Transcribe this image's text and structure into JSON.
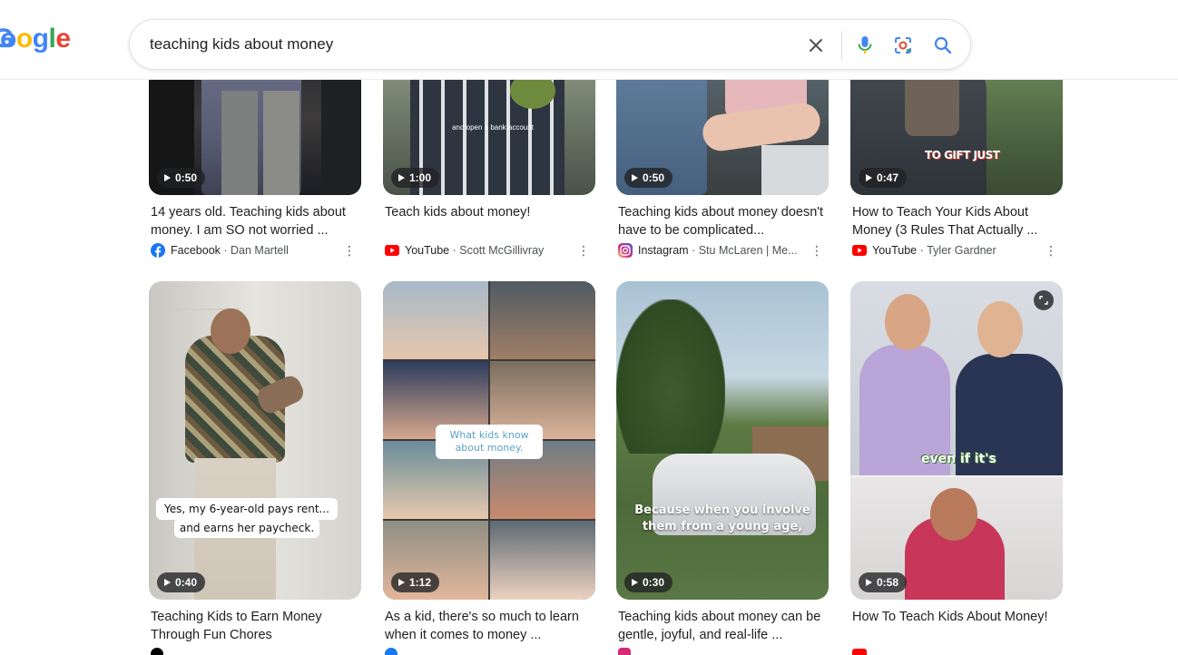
{
  "search": {
    "query": "teaching kids about money"
  },
  "logo": {
    "text_visible": "oogle"
  },
  "colors": {
    "facebook": "#1877f2",
    "youtube": "#ff0000",
    "instagram": "#e1306c",
    "tiktok": "#000000"
  },
  "row1": [
    {
      "duration": "0:50",
      "title": "14 years old. Teaching kids about money. I am SO not worried ...",
      "source_name": "Facebook",
      "source_author": "Dan Martell",
      "source_icon": "facebook-icon"
    },
    {
      "duration": "1:00",
      "title": "Teach kids about money!",
      "source_name": "YouTube",
      "source_author": "Scott McGillivray",
      "source_icon": "youtube-icon",
      "overlay_text": "and open a bank account"
    },
    {
      "duration": "0:50",
      "title": "Teaching kids about money doesn't have to be complicated...",
      "source_name": "Instagram",
      "source_author": "Stu McLaren | Me...",
      "source_icon": "instagram-icon"
    },
    {
      "duration": "0:47",
      "title": "How to Teach Your Kids About Money (3 Rules That Actually ...",
      "source_name": "YouTube",
      "source_author": "Tyler Gardner",
      "source_icon": "youtube-icon",
      "overlay_text": "TO GIFT JUST"
    }
  ],
  "row2": [
    {
      "duration": "0:40",
      "title": "Teaching Kids to Earn Money Through Fun Chores",
      "overlay_line1": "Yes, my 6-year-old pays rent...",
      "overlay_line2": "and earns her paycheck."
    },
    {
      "duration": "1:12",
      "title": "As a kid, there's so much to learn when it comes to money ...",
      "overlay_line1": "What kids know",
      "overlay_line2": "about money."
    },
    {
      "duration": "0:30",
      "title": "Teaching kids about money can be gentle, joyful, and real-life ...",
      "overlay_line1": "Because when you involve",
      "overlay_line2": "them from a young age,"
    },
    {
      "duration": "0:58",
      "title": "How To Teach Kids About Money!",
      "overlay_text": "even if it's"
    }
  ]
}
